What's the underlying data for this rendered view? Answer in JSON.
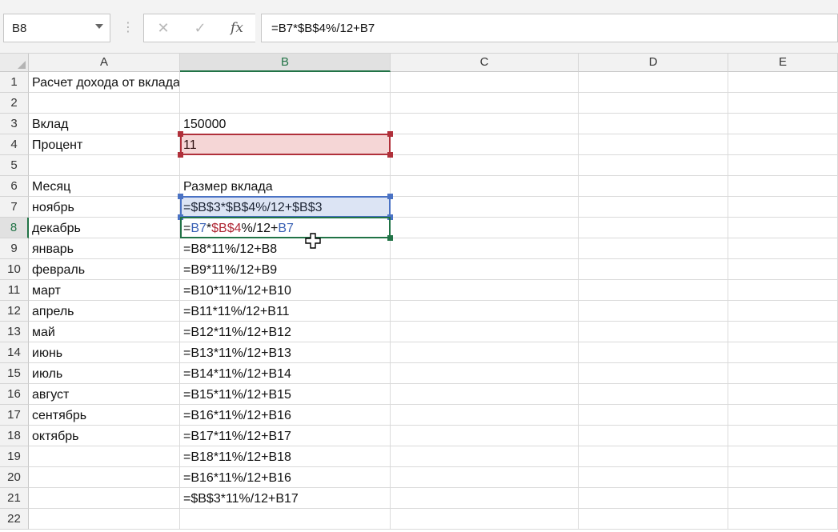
{
  "name_box": {
    "value": "B8"
  },
  "formula_bar": {
    "separator": "⋮",
    "cancel_glyph": "✕",
    "enter_glyph": "✓",
    "fx_label": "fx",
    "formula": "=B7*$B$4%/12+B7"
  },
  "columns": [
    "A",
    "B",
    "C",
    "D",
    "E"
  ],
  "rows": [
    "1",
    "2",
    "3",
    "4",
    "5",
    "6",
    "7",
    "8",
    "9",
    "10",
    "11",
    "12",
    "13",
    "14",
    "15",
    "16",
    "17",
    "18",
    "19",
    "20",
    "21",
    "22"
  ],
  "cells": {
    "A1": "Расчет дохода от вклада",
    "A3": "Вклад",
    "B3": "150000",
    "A4": "Процент",
    "B4": "11",
    "A6": "Месяц",
    "B6": "Размер вклада",
    "A7": "ноябрь",
    "B7": "=$B$3*$B$4%/12+$B$3",
    "A8": "декабрь",
    "B8_parts": [
      "=",
      "B7",
      "*",
      "$B$4",
      "%/12+",
      "B7"
    ],
    "A9": "январь",
    "B9": "=B8*11%/12+B8",
    "A10": "февраль",
    "B10": "=B9*11%/12+B9",
    "A11": "март",
    "B11": "=B10*11%/12+B10",
    "A12": "апрель",
    "B12": "=B11*11%/12+B11",
    "A13": "май",
    "B13": "=B12*11%/12+B12",
    "A14": "июнь",
    "B14": "=B13*11%/12+B13",
    "A15": "июль",
    "B15": "=B14*11%/12+B14",
    "A16": "август",
    "B16": "=B15*11%/12+B15",
    "A17": "сентябрь",
    "B17": "=B16*11%/12+B16",
    "A18": "октябрь",
    "B18": "=B17*11%/12+B17",
    "B19": "=B18*11%/12+B18",
    "B20": "=B16*11%/12+B16",
    "B21": "=$B$3*11%/12+B17"
  },
  "colors": {
    "excel_green": "#217346",
    "ref_blue": "#4a72c4",
    "ref_red": "#b0303a"
  }
}
